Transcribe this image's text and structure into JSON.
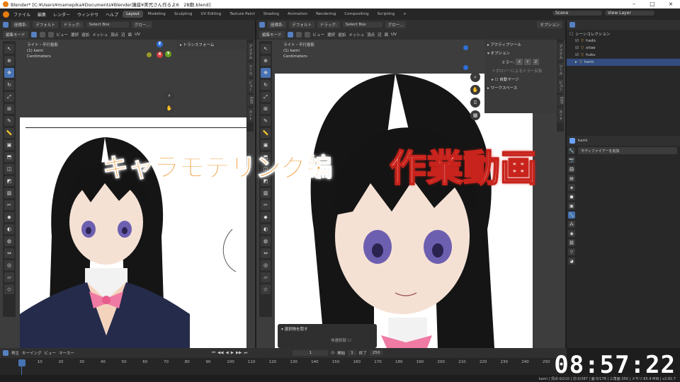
{
  "window": {
    "title": "Blender* [C:¥Users¥mamepika¥Documents¥Blender講座¥美咒さん作るよ6　2B動.blend]",
    "controls": [
      "–",
      "□",
      "×"
    ]
  },
  "menubar": {
    "items": [
      "ファイル",
      "編集",
      "レンダー",
      "ウィンドウ",
      "ヘルプ"
    ],
    "workspace_tabs": [
      "Layout",
      "Modeling",
      "Sculpting",
      "UV Editing",
      "Texture Paint",
      "Shading",
      "Animation",
      "Rendering",
      "Compositing",
      "Scripting"
    ],
    "active_tab": "Layout",
    "add_tab": "+",
    "scene_label": "Scene",
    "view_layer_label": "View Layer"
  },
  "left_viewport": {
    "header": {
      "mode": "編集モード",
      "menus": [
        "ビュー",
        "選択",
        "追加",
        "メッシュ",
        "頂点",
        "辺",
        "面",
        "UV"
      ],
      "transform_orientation": "座標系:",
      "pivot": "デフォルト",
      "drag": "ドラッグ:",
      "select_box": "Select Box",
      "global": "グロー..."
    },
    "overlay_text": [
      "ライト・平行投影",
      "(1) kami",
      "Centimeters"
    ],
    "npanel_title": "トランスフォーム",
    "sidebar_tabs": [
      "アイテム",
      "ツール",
      "ビュー",
      "Edit",
      "ルート"
    ],
    "gizmo": {
      "z": "Z",
      "y": "Y",
      "x": "X"
    }
  },
  "right_viewport": {
    "header": {
      "mode": "編集モード",
      "menus": [
        "ビュー",
        "選択",
        "追加",
        "メッシュ",
        "頂点",
        "辺",
        "面",
        "UV"
      ],
      "transform_orientation": "座標系:",
      "pivot": "デフォルト",
      "drag": "ドラッグ:",
      "select_box": "Select Box",
      "global": "グロー...",
      "options": "オプション"
    },
    "overlay_text": [
      "ライト・平行投影",
      "(1) kami",
      "Centimeters"
    ],
    "npanel": {
      "active_tool": "アクティブツール",
      "options": "オプション",
      "mirror_label": "ミラー:",
      "mirror_axes": [
        "X",
        "Y",
        "Z"
      ],
      "topology_mirror": "トポロジーによるミラー反転",
      "auto_merge": "自動マージ",
      "workspace": "ワークスペース"
    },
    "sidebar_tabs": [
      "アイテム",
      "ツール",
      "ビュー",
      "Edit",
      "ルート"
    ],
    "last_op": {
      "title": "選択物を隠す",
      "unselected": "非選択部"
    }
  },
  "outliner": {
    "title": "シーンコレクション",
    "rows": [
      {
        "name": "hado"
      },
      {
        "name": "sitae"
      },
      {
        "name": "huku"
      },
      {
        "name": "kami"
      }
    ],
    "selected_row": "kami"
  },
  "properties": {
    "object_name": "kami",
    "add_modifier": "モディファイアーを追加"
  },
  "timeline": {
    "menus": [
      "再生",
      "キーイング",
      "ビュー",
      "マーカー"
    ],
    "current_frame": "1",
    "start_label": "開始",
    "start": "1",
    "end_label": "終了",
    "end": "250",
    "ruler": [
      "1",
      "10",
      "20",
      "30",
      "40",
      "50",
      "60",
      "70",
      "80",
      "90",
      "100",
      "110",
      "120",
      "130",
      "140",
      "150",
      "160",
      "170",
      "180",
      "190",
      "200",
      "210",
      "220",
      "230",
      "240",
      "250"
    ]
  },
  "statusbar": {
    "text": "kami | 頂点:0/210 | 辺:0/387 | 面:0/178 | 三角面:356 | メモリ:85.4 MiB | v2.82.7"
  },
  "overlay": {
    "title_orange": "キャラモデリング編",
    "title_white": "作業動画",
    "clock": "08:57:22",
    "colors": {
      "orange": "#f0922a",
      "red": "#c8231c"
    }
  },
  "colors": {
    "accent": "#4772b3",
    "viewport_bg": "#3d3d3d",
    "panel_bg": "#282828"
  }
}
